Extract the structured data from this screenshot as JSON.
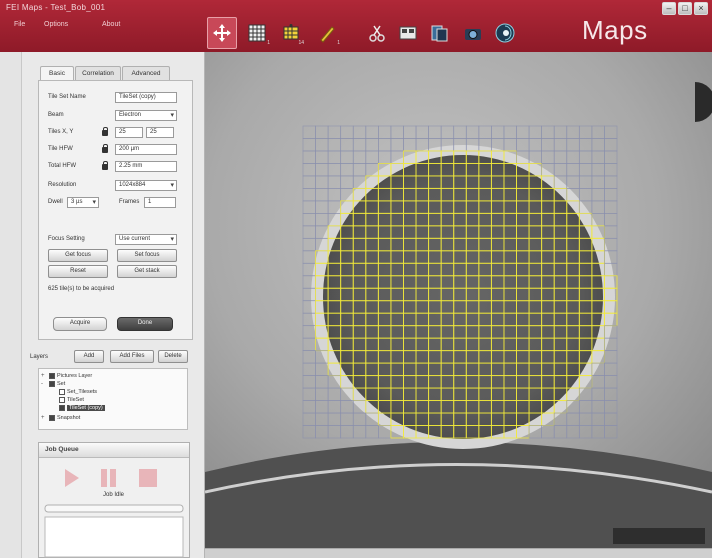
{
  "window": {
    "title": "FEI Maps - Test_Bob_001",
    "brand": "Maps"
  },
  "menu": [
    "File",
    "Options",
    "About"
  ],
  "toolbar": {
    "buttons": [
      {
        "name": "move-tool",
        "icon": "crosshair-arrows-icon",
        "active": true
      },
      {
        "name": "tile-set-tool",
        "icon": "grid-icon"
      },
      {
        "name": "tile-set-stitch-tool",
        "icon": "stitch-grid-icon"
      },
      {
        "name": "measure-tool",
        "icon": "pencil-icon"
      },
      {
        "name": "cut-tool",
        "icon": "scissors-icon"
      },
      {
        "name": "layout-tool",
        "icon": "layout-icon"
      },
      {
        "name": "image-tool",
        "icon": "image-stack-icon"
      },
      {
        "name": "camera-tool",
        "icon": "camera-icon"
      },
      {
        "name": "navigation-tool",
        "icon": "globe-icon"
      }
    ]
  },
  "panel": {
    "tabs": [
      "Basic",
      "Correlation",
      "Advanced"
    ],
    "active_tab": "Basic",
    "rows": [
      {
        "label": "Tile Set Name",
        "value": "TileSet (copy)"
      },
      {
        "label": "Beam",
        "value": "Electron"
      },
      {
        "label": "Tiles X, Y",
        "value_x": "25",
        "value_y": "25"
      },
      {
        "label": "Tile HFW",
        "value": "200 µm"
      },
      {
        "label": "Total HFW",
        "value": "2.25 mm"
      },
      {
        "label": "Resolution",
        "value": "1024x884"
      },
      {
        "label": "Dwell",
        "value": "3 µs",
        "frames_label": "Frames",
        "frames_value": "1"
      }
    ],
    "focus_label": "Focus Setting",
    "focus_value": "Use current",
    "focus_buttons": [
      "Get focus",
      "Set focus",
      "Reset",
      "Get stack"
    ],
    "tiles_note": "625 tile(s) to be acquired",
    "actions": [
      "Acquire",
      "Done"
    ]
  },
  "layers": {
    "label": "Layers",
    "buttons": [
      "Add",
      "Add Files",
      "Delete"
    ],
    "tree": [
      {
        "label": "Pictures Layer",
        "level": 0,
        "expander": "+",
        "checked": true
      },
      {
        "label": "Set",
        "level": 0,
        "expander": "-",
        "checked": true
      },
      {
        "label": "Set_Tilesets",
        "level": 1,
        "expander": "",
        "checked": false
      },
      {
        "label": "TileSet",
        "level": 1,
        "expander": "",
        "checked": false
      },
      {
        "label": "TileSet (copy)",
        "level": 1,
        "expander": "",
        "checked": true,
        "selected": true
      },
      {
        "label": "Snapshot",
        "level": 0,
        "expander": "+",
        "checked": true
      }
    ]
  },
  "job_queue": {
    "title": "Job Queue",
    "idle_text": "Job Idle"
  },
  "viewport": {
    "grid_columns": 25,
    "grid_rows": 25,
    "grid_color": "#8a8fae",
    "highlight_color": "#f2ea3a"
  },
  "colors": {
    "header": "#9c1f2e",
    "accent_active": "#c84858"
  }
}
